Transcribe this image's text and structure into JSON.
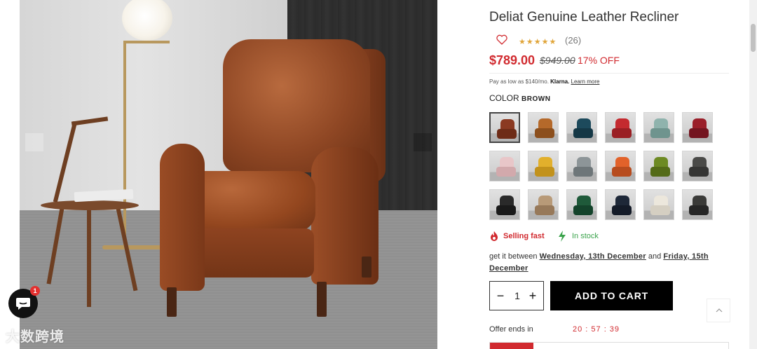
{
  "product": {
    "title": "Deliat Genuine Leather Recliner",
    "rating_stars": "★★★★★",
    "rating_count": "(26)",
    "price": "$789.00",
    "compare_price": "$949.00",
    "discount": "17% OFF"
  },
  "klarna": {
    "prefix": "Pay as low as $140/mo. ",
    "brand": "Klarna.",
    "link": "Learn more"
  },
  "color": {
    "label": "COLOR",
    "selected": "BROWN",
    "swatches": [
      {
        "back": "#8b3a22",
        "seat": "#6e2c17",
        "selected": true
      },
      {
        "back": "#b5692a",
        "seat": "#8c4f1d",
        "selected": false
      },
      {
        "back": "#1d4a5c",
        "seat": "#153846",
        "selected": false
      },
      {
        "back": "#c42a2f",
        "seat": "#9a1f24",
        "selected": false
      },
      {
        "back": "#8fb3ad",
        "seat": "#6f948e",
        "selected": false
      },
      {
        "back": "#9a1f2a",
        "seat": "#741520",
        "selected": false
      },
      {
        "back": "#e8c6c8",
        "seat": "#d2a9ac",
        "selected": false
      },
      {
        "back": "#e2b02c",
        "seat": "#c2921c",
        "selected": false
      },
      {
        "back": "#8d9598",
        "seat": "#6e7679",
        "selected": false
      },
      {
        "back": "#e2622a",
        "seat": "#b74c1e",
        "selected": false
      },
      {
        "back": "#6d8a23",
        "seat": "#546b18",
        "selected": false
      },
      {
        "back": "#4a4a48",
        "seat": "#353534",
        "selected": false
      },
      {
        "back": "#2a2a2a",
        "seat": "#1a1a1a",
        "selected": false
      },
      {
        "back": "#b89a78",
        "seat": "#97795a",
        "selected": false
      },
      {
        "back": "#1f5a3a",
        "seat": "#14432b",
        "selected": false
      },
      {
        "back": "#1e2838",
        "seat": "#141b28",
        "selected": false
      },
      {
        "back": "#ece7dc",
        "seat": "#d5cfc2",
        "selected": false
      },
      {
        "back": "#3a3a38",
        "seat": "#262626",
        "selected": false
      }
    ]
  },
  "status": {
    "selling_fast": "Selling fast",
    "in_stock": "In stock"
  },
  "delivery": {
    "prefix": "get it between ",
    "date_start": "Wednesday, 13th December",
    "middle": " and ",
    "date_end": "Friday, 15th December"
  },
  "cart": {
    "quantity": "1",
    "minus": "−",
    "plus": "+",
    "add_label": "ADD TO CART"
  },
  "offer": {
    "label": "Offer ends in",
    "timer": "20 : 57 : 39"
  },
  "chat": {
    "badge": "1"
  },
  "watermark": "大数跨境",
  "colors": {
    "sale_red": "#d12a2f",
    "stock_green": "#3aa34b",
    "button_black": "#000000"
  }
}
